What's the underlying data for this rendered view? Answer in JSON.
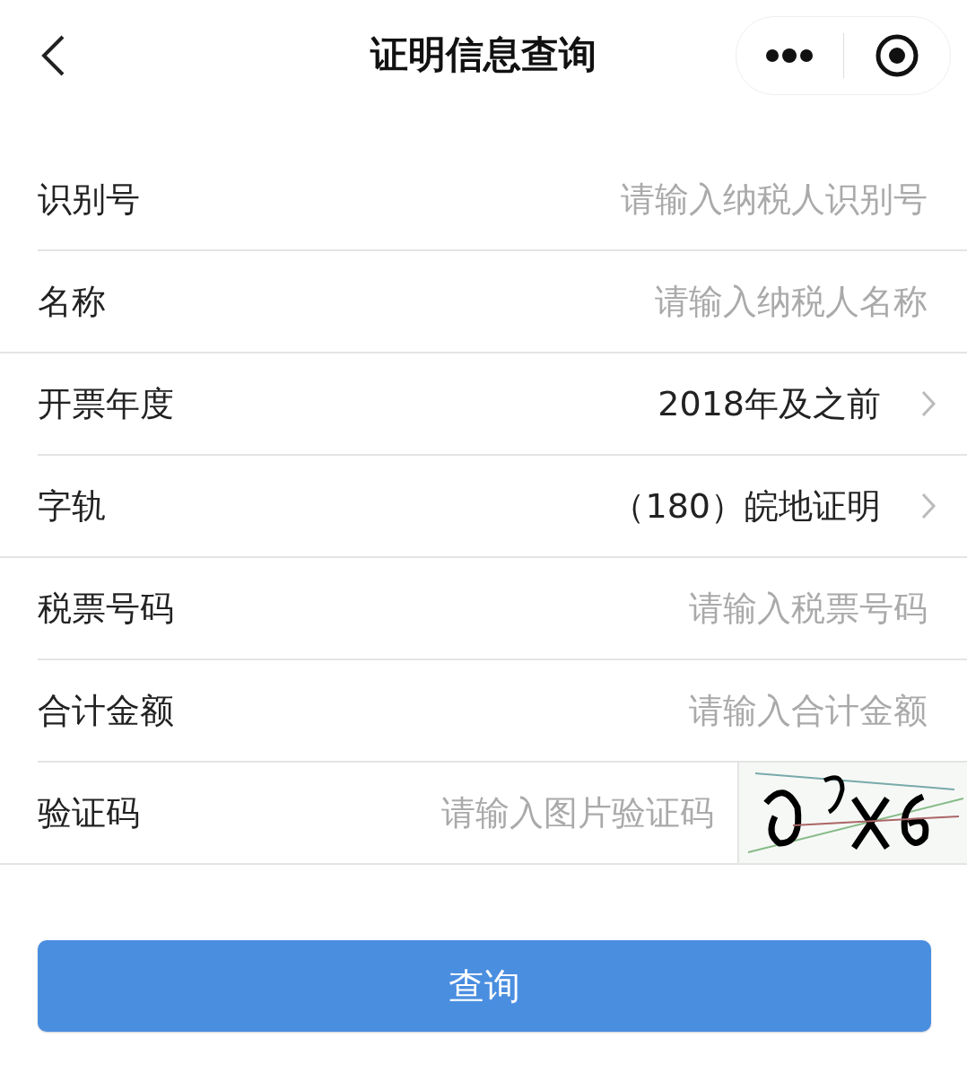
{
  "header": {
    "title": "证明信息查询"
  },
  "rows": [
    {
      "kind": "input",
      "label": "识别号",
      "placeholder": "请输入纳税人识别号",
      "full_divider": false
    },
    {
      "kind": "input",
      "label": "名称",
      "placeholder": "请输入纳税人名称",
      "full_divider": true
    },
    {
      "kind": "select",
      "label": "开票年度",
      "value": "2018年及之前",
      "full_divider": false
    },
    {
      "kind": "select",
      "label": "字轨",
      "value": "（180）皖地证明",
      "full_divider": true
    },
    {
      "kind": "input",
      "label": "税票号码",
      "placeholder": "请输入税票号码",
      "full_divider": false
    },
    {
      "kind": "input",
      "label": "合计金额",
      "placeholder": "请输入合计金额",
      "full_divider": false
    },
    {
      "kind": "captcha",
      "label": "验证码",
      "placeholder": "请输入图片验证码",
      "full_divider": true
    }
  ],
  "submit": {
    "label": "查询"
  }
}
